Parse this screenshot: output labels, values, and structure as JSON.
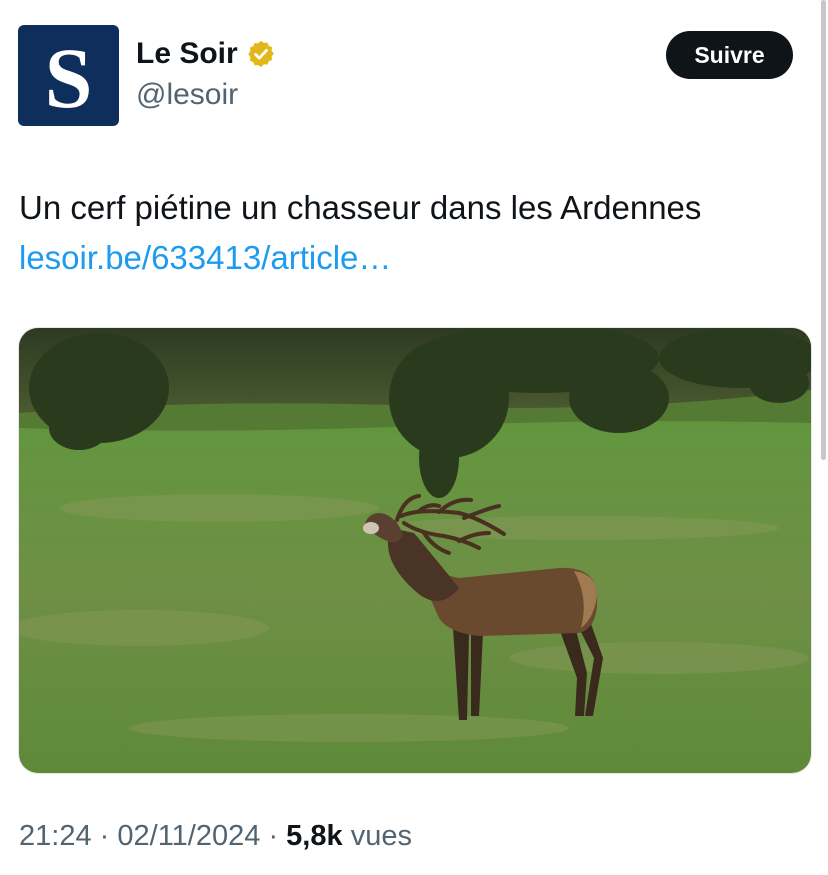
{
  "account": {
    "avatar_letter": "S",
    "avatar_color": "#0e2f5c",
    "display_name": "Le Soir",
    "verified_badge": "verified-badge-icon",
    "badge_color": "#e2b719",
    "handle": "@lesoir"
  },
  "follow_button": {
    "label": "Suivre"
  },
  "tweet": {
    "text": "Un cerf piétine un chasseur dans les Ardennes",
    "link_text": "lesoir.be/633413/article…",
    "link_color": "#1d9bf0"
  },
  "media": {
    "image_icon": "photo-of-stag-in-meadow"
  },
  "meta": {
    "time": "21:24",
    "date": "02/11/2024",
    "views_count": "5,8k",
    "views_label": "vues",
    "separator": "·"
  }
}
